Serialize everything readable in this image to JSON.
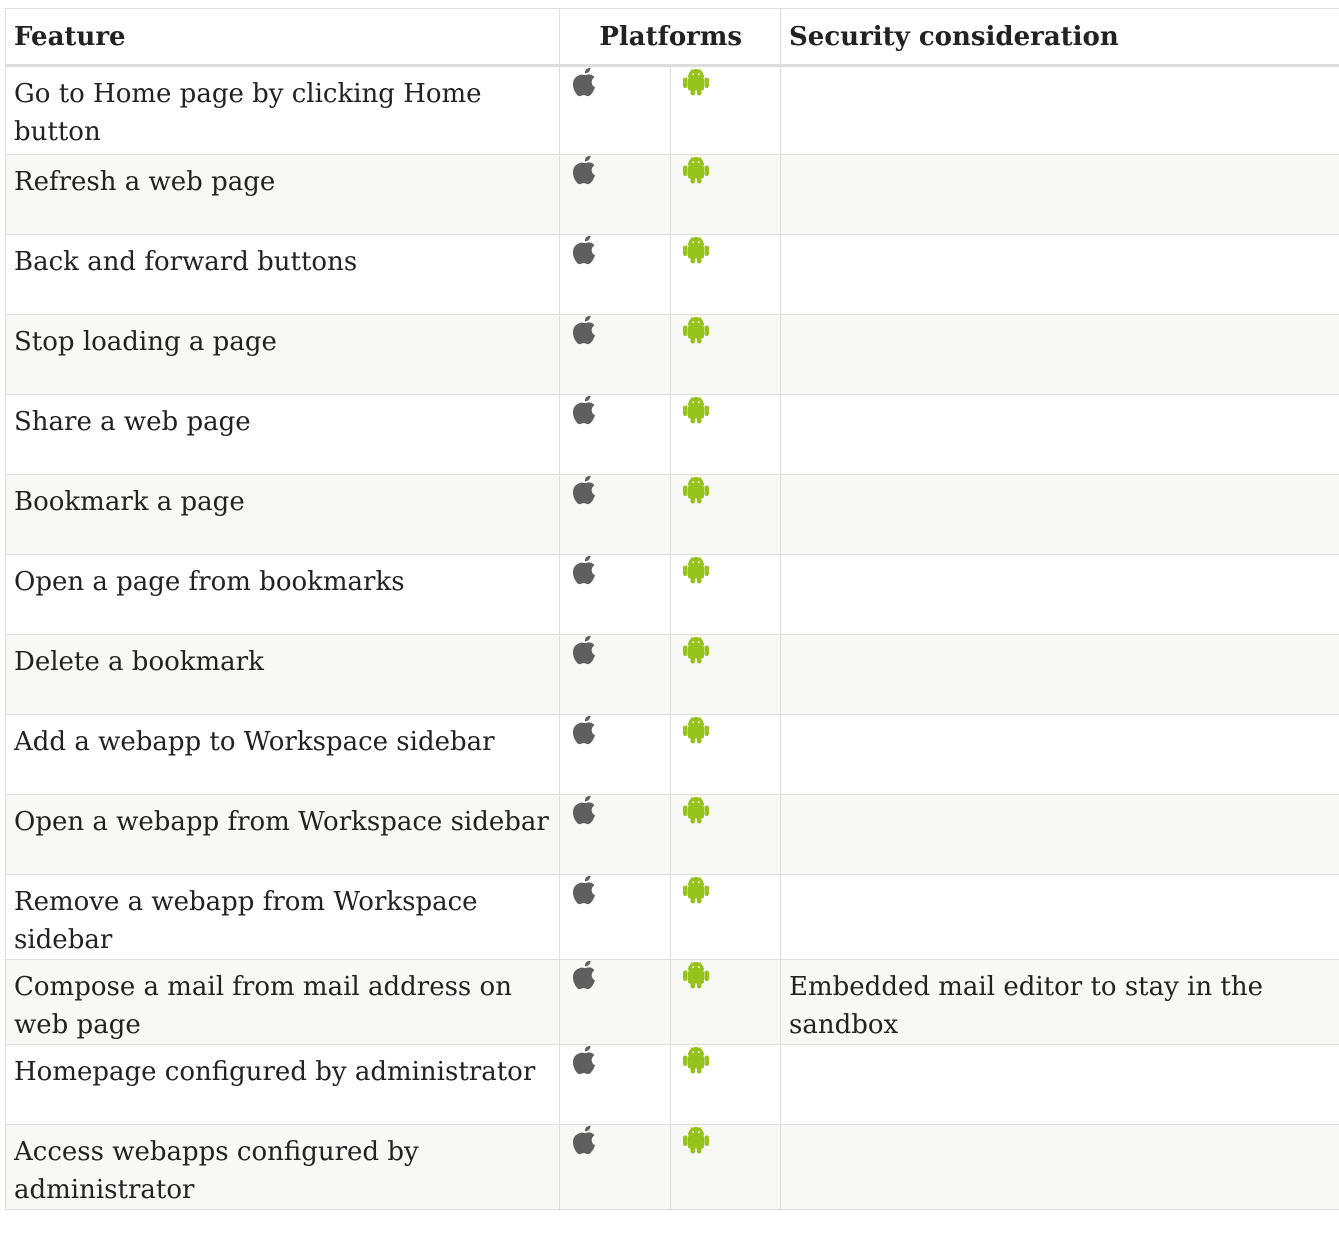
{
  "table": {
    "headers": {
      "feature": "Feature",
      "platforms": "Platforms",
      "security": "Security consideration"
    },
    "platform_icons": {
      "ios": "apple-icon",
      "android": "android-icon"
    },
    "icon_colors": {
      "apple": "#5f5f5f",
      "android": "#96c21c"
    },
    "rows": [
      {
        "feature": "Go to Home page by clicking Home button",
        "security": ""
      },
      {
        "feature": "Refresh a web page",
        "security": ""
      },
      {
        "feature": "Back and forward buttons",
        "security": ""
      },
      {
        "feature": "Stop loading a page",
        "security": ""
      },
      {
        "feature": "Share a web page",
        "security": ""
      },
      {
        "feature": "Bookmark a page",
        "security": ""
      },
      {
        "feature": "Open a page from bookmarks",
        "security": ""
      },
      {
        "feature": "Delete a bookmark",
        "security": ""
      },
      {
        "feature": "Add a webapp to Workspace sidebar",
        "security": ""
      },
      {
        "feature": "Open a webapp from Workspace sidebar",
        "security": ""
      },
      {
        "feature": "Remove a webapp from Workspace sidebar",
        "security": ""
      },
      {
        "feature": "Compose a mail from mail address on web page",
        "security": "Embedded mail editor to stay in the sandbox"
      },
      {
        "feature": "Homepage configured by administrator",
        "security": ""
      },
      {
        "feature": "Access webapps configured by administrator",
        "security": ""
      }
    ]
  }
}
